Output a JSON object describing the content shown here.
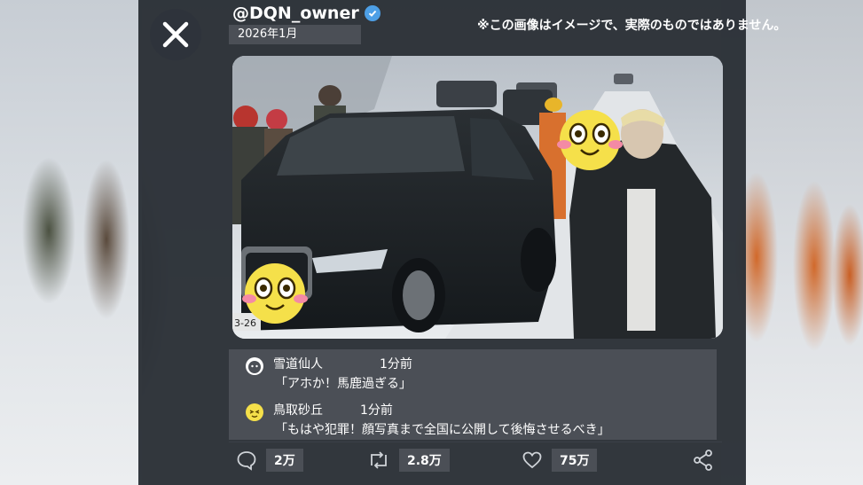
{
  "post": {
    "handle": "@DQN_owner",
    "date": "2026年1月",
    "disclaimer": "※この画像はイメージで、実際のものではありません。"
  },
  "comments": [
    {
      "name": "雪道仙人",
      "time": "1分前",
      "text": "「アホか！馬鹿過ぎる」",
      "avatar_icon": "outline-face-icon"
    },
    {
      "name": "鳥取砂丘",
      "time": "1分前",
      "text": "「もはや犯罪！顔写真まで全国に公開して後悔させるべき」",
      "avatar_icon": "smiley-face-icon"
    }
  ],
  "actions": {
    "reply_count": "2万",
    "repost_count": "2.8万",
    "like_count": "75万"
  },
  "colors": {
    "panel": "#282d34",
    "label_bg": "#4b4f56",
    "verified": "#4d9fe6",
    "emoji_yellow": "#f5e04a"
  },
  "photo": {
    "plate_text": "3-26"
  }
}
